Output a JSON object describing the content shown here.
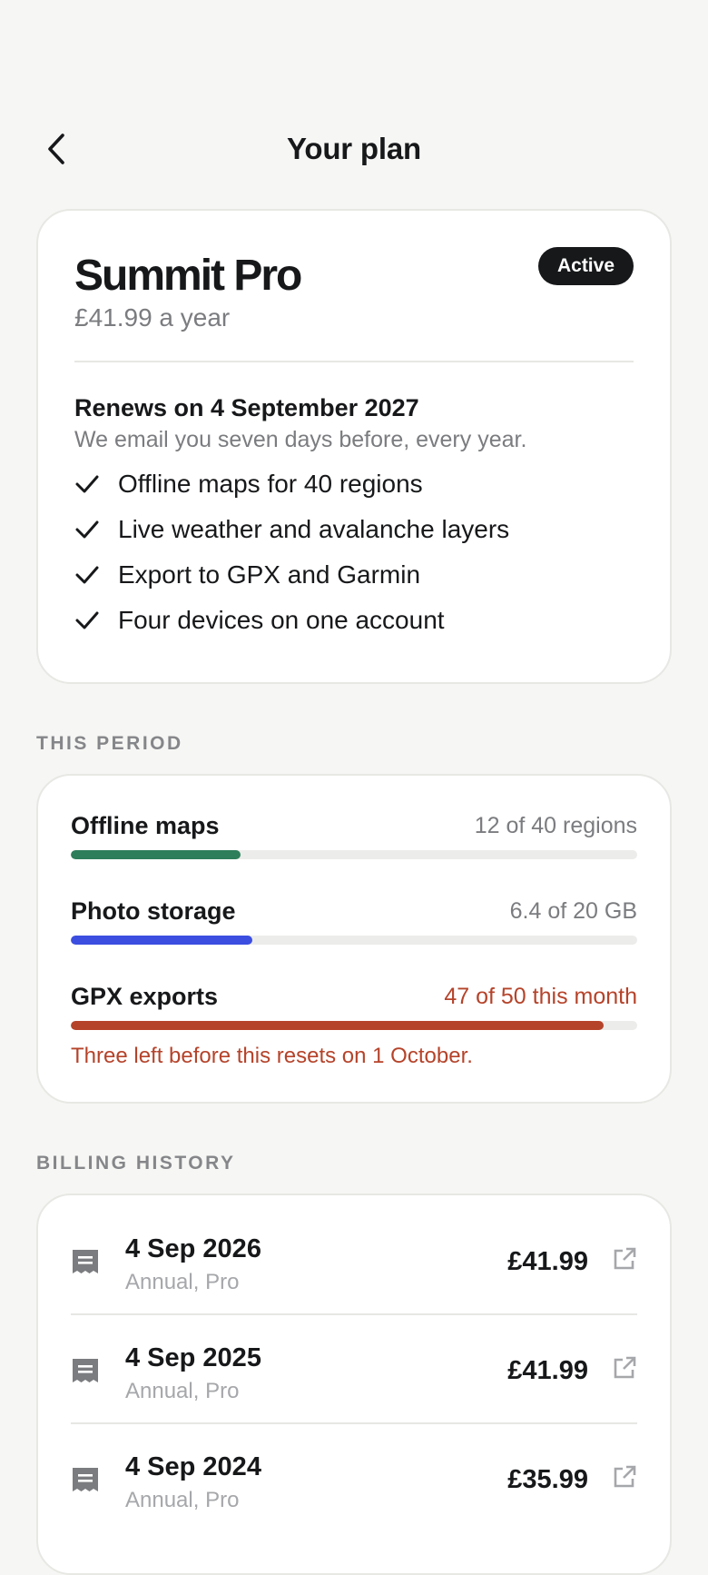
{
  "header": {
    "title": "Your plan",
    "back_icon": "chevron-left-icon"
  },
  "plan": {
    "name": "Summit Pro",
    "status": "Active",
    "price": "£41.99 a year",
    "renew_title": "Renews on 4 September 2027",
    "renew_note": "We email you seven days before, every year.",
    "features": [
      {
        "label": "Offline maps for 40 regions",
        "icon": "check-icon"
      },
      {
        "label": "Live weather and avalanche layers",
        "icon": "check-icon"
      },
      {
        "label": "Export to GPX and Garmin",
        "icon": "check-icon"
      },
      {
        "label": "Four devices on one account",
        "icon": "check-icon"
      }
    ]
  },
  "usage": {
    "section_label": "THIS PERIOD",
    "meters": [
      {
        "label": "Offline maps",
        "value": "12 of 40 regions",
        "fraction": 0.3,
        "color": "#2e7d5b"
      },
      {
        "label": "Photo storage",
        "value": "6.4 of 20 GB",
        "fraction": 0.32,
        "color": "#3b4ee0"
      },
      {
        "label": "GPX exports",
        "value": "47 of 50 this month",
        "fraction": 0.94,
        "color": "#b5432a"
      }
    ],
    "warning": "Three left before this resets on 1 October."
  },
  "billing": {
    "section_label": "BILLING HISTORY",
    "rows": [
      {
        "date": "4 Sep 2026",
        "plan": "Annual, Pro",
        "amount": "£41.99",
        "icon": "receipt-icon",
        "link_icon": "external-link-icon"
      },
      {
        "date": "4 Sep 2025",
        "plan": "Annual, Pro",
        "amount": "£41.99",
        "icon": "receipt-icon",
        "link_icon": "external-link-icon"
      },
      {
        "date": "4 Sep 2024",
        "plan": "Annual, Pro",
        "amount": "£35.99",
        "icon": "receipt-icon",
        "link_icon": "external-link-icon"
      }
    ]
  },
  "colors": {
    "background": "#f6f6f4",
    "text": "#17181a",
    "muted": "#7b7c7f",
    "warning": "#b5432a"
  }
}
